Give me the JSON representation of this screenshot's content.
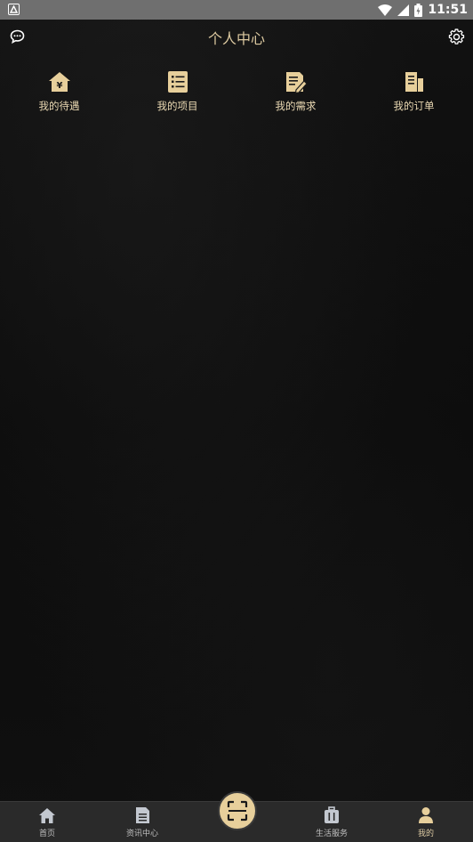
{
  "status_bar": {
    "time": "11:51",
    "icons": [
      "android-notification-icon",
      "wifi-icon",
      "cellular-signal-icon",
      "battery-charging-icon"
    ]
  },
  "header": {
    "title": "个人中心",
    "left_icon": "message-bubble-icon",
    "right_icon": "gear-icon"
  },
  "quick_menu": [
    {
      "label": "我的待遇",
      "icon": "house-yen-icon"
    },
    {
      "label": "我的项目",
      "icon": "list-document-icon"
    },
    {
      "label": "我的需求",
      "icon": "edit-document-icon"
    },
    {
      "label": "我的订单",
      "icon": "building-icon"
    }
  ],
  "tab_bar": {
    "items": [
      {
        "label": "首页",
        "icon": "home-icon",
        "active": false
      },
      {
        "label": "资讯中心",
        "icon": "news-document-icon",
        "active": false
      },
      {
        "label": "生活服务",
        "icon": "luggage-icon",
        "active": false
      },
      {
        "label": "我的",
        "icon": "person-icon",
        "active": true
      }
    ],
    "center_icon": "scan-frame-icon"
  },
  "colors": {
    "accent_gold": "#e7cf9b",
    "title_gold": "#dcc9a0",
    "tab_bar_bg": "#2a2a2a",
    "status_bar_bg": "#6f6f6f",
    "inactive_icon": "#bfc4cc"
  }
}
